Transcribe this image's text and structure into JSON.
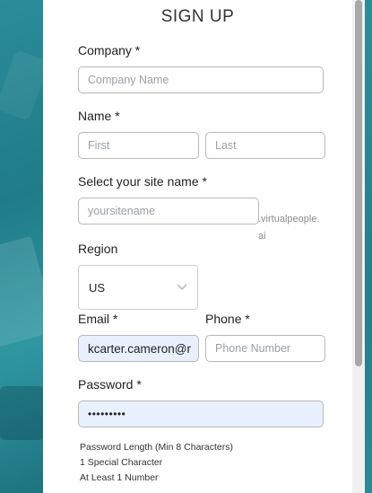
{
  "form": {
    "title": "SIGN UP",
    "company": {
      "label": "Company *",
      "placeholder": "Company Name"
    },
    "name": {
      "label": "Name *",
      "first_placeholder": "First",
      "last_placeholder": "Last"
    },
    "site": {
      "label": "Select your site name *",
      "placeholder": "yoursitename",
      "suffix": ".virtualpeople.ai"
    },
    "region": {
      "label": "Region",
      "value": "US"
    },
    "email": {
      "label": "Email *",
      "value": "kcarter.cameron@r"
    },
    "phone": {
      "label": "Phone *",
      "placeholder": "Phone Number"
    },
    "password": {
      "label": "Password *",
      "value": "•••••••••"
    },
    "password_rules": [
      "Password Length (Min 8 Characters)",
      "1 Special Character",
      "At Least 1 Number"
    ]
  },
  "icons": {
    "region_dropdown": "chevron-down-icon"
  },
  "colors": {
    "accent_teal": "#2a8d99",
    "autofill_bg": "#e8f0fe"
  }
}
